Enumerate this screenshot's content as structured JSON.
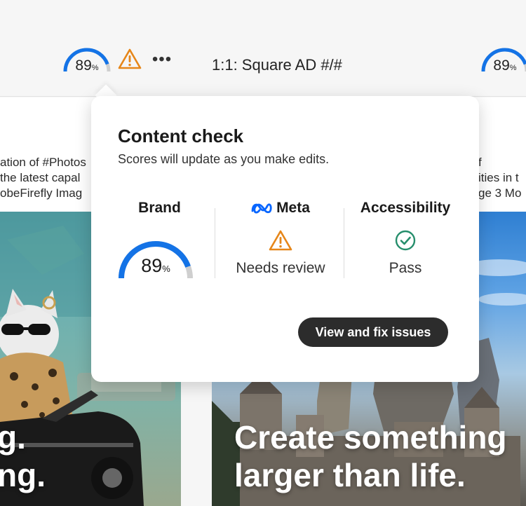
{
  "toolbar": {
    "score_left": "89",
    "score_right": "89",
    "score_unit": "%",
    "variant_title": "1:1: Square AD #/#",
    "more_label": "•••"
  },
  "cards": {
    "left_copy": [
      "ation of #Photos",
      "the latest capal",
      "obeFirefly Imag"
    ],
    "left_headline": [
      "g.",
      "ng."
    ],
    "right_copy": [
      "f",
      "ities in t",
      "ge 3 Mo"
    ],
    "right_headline": [
      "Create something",
      "larger than life."
    ]
  },
  "popover": {
    "title": "Content check",
    "subtitle": "Scores will update as you make edits.",
    "brand": {
      "label": "Brand",
      "score": "89",
      "unit": "%",
      "score_fraction": 0.89
    },
    "meta": {
      "label": "Meta",
      "status": "Needs review"
    },
    "accessibility": {
      "label": "Accessibility",
      "status": "Pass"
    },
    "fix_button": "View and fix issues"
  },
  "colors": {
    "gauge_blue": "#1473e6",
    "gauge_track": "#cfcfcf",
    "warning_orange": "#e68619",
    "pass_green": "#268e6c",
    "meta_blue": "#0866ff",
    "button_dark": "#2c2c2c"
  },
  "icons": {
    "warning": "warning-triangle-icon",
    "pass": "checkmark-circle-icon",
    "meta": "meta-logo-icon",
    "more": "more-horizontal-icon"
  }
}
